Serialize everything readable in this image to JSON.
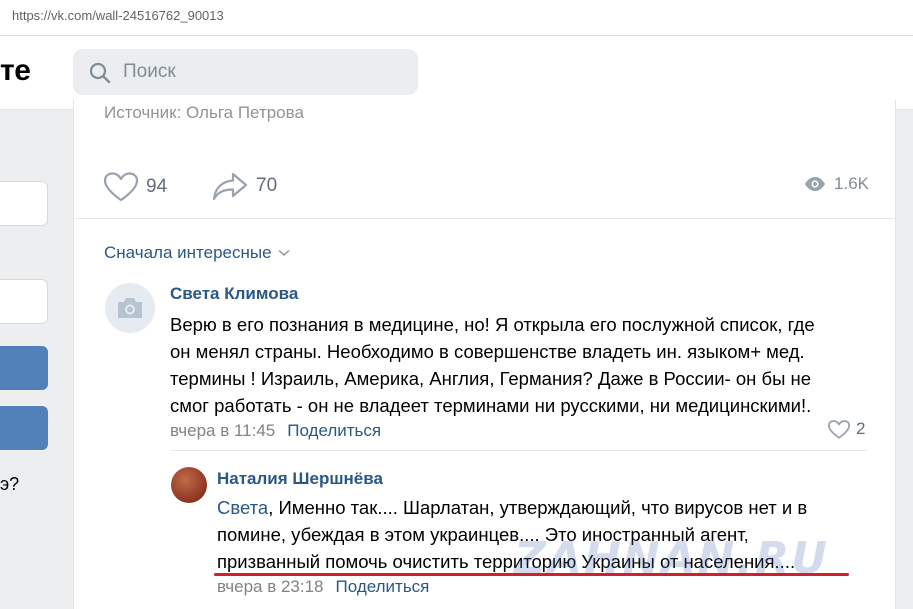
{
  "browser": {
    "url": "https://vk.com/wall-24516762_90013"
  },
  "header": {
    "logo": "те",
    "search_placeholder": "Поиск"
  },
  "sidebar": {
    "partial_text": "э?"
  },
  "post": {
    "source_text": "Источник: Ольга Петрова",
    "likes": "94",
    "shares": "70",
    "views": "1.6K"
  },
  "comments": {
    "sort_label": "Сначала интересные",
    "items": [
      {
        "author": "Света Климова",
        "lines": [
          "Верю в его познания в медицине, но! Я открыла его послужной список, где",
          "он менял страны. Необходимо в совершенстве владеть ин. языком+ мед.",
          "термины ! Израиль, Америка, Англия, Германия? Даже в России- он бы не",
          "смог работать - он не владеет терминами ни русскими, ни медицинскими!."
        ],
        "time": "вчера в 11:45",
        "share_label": "Поделиться",
        "likes": "2"
      }
    ],
    "reply": {
      "author": "Наталия Шершнёва",
      "reply_to": "Света",
      "lines": [
        ", Именно так.... Шарлатан, утверждающий, что вирусов нет и в",
        "помине, убеждая в этом украинцев.... Это иностранный агент,",
        "призванный помочь очистить территорию Украины от населения...."
      ],
      "time": "вчера в 23:18",
      "share_label": "Поделиться"
    }
  },
  "watermark": "ZAHNAN.RU",
  "colors": {
    "link": "#2a5885",
    "accent": "#5181b8",
    "underline": "#d0202a"
  }
}
